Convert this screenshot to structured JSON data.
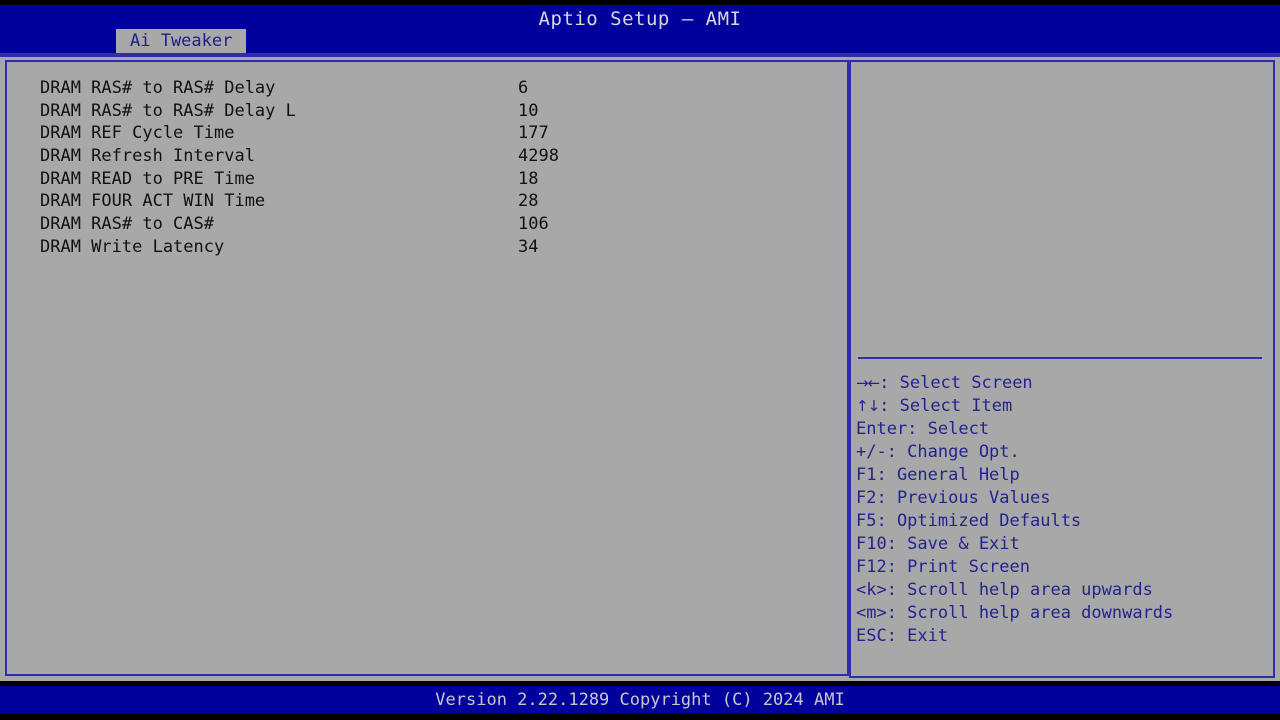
{
  "header": {
    "title": "Aptio Setup – AMI",
    "tabs": [
      {
        "label": "Ai Tweaker",
        "active": true
      }
    ]
  },
  "main": {
    "settings": [
      {
        "label": "DRAM RAS# to RAS# Delay",
        "value": "6"
      },
      {
        "label": "DRAM RAS# to RAS# Delay L",
        "value": "10"
      },
      {
        "label": "DRAM REF Cycle Time",
        "value": "177"
      },
      {
        "label": "DRAM Refresh Interval",
        "value": "4298"
      },
      {
        "label": "DRAM READ to PRE Time",
        "value": "18"
      },
      {
        "label": "DRAM FOUR ACT WIN Time",
        "value": "28"
      },
      {
        "label": "DRAM RAS# to CAS#",
        "value": "106"
      },
      {
        "label": "DRAM Write Latency",
        "value": "34"
      }
    ]
  },
  "help": {
    "description": "",
    "keys": [
      {
        "glyph": "→←",
        "text": ": Select Screen"
      },
      {
        "glyph": "↑↓",
        "text": ": Select Item"
      },
      {
        "glyph": "",
        "text": "Enter: Select"
      },
      {
        "glyph": "",
        "text": "+/-: Change Opt."
      },
      {
        "glyph": "",
        "text": "F1: General Help"
      },
      {
        "glyph": "",
        "text": "F2: Previous Values"
      },
      {
        "glyph": "",
        "text": "F5: Optimized Defaults"
      },
      {
        "glyph": "",
        "text": "F10: Save & Exit"
      },
      {
        "glyph": "",
        "text": "F12: Print Screen"
      },
      {
        "glyph": "",
        "text": "<k>: Scroll help area upwards"
      },
      {
        "glyph": "",
        "text": "<m>: Scroll help area downwards"
      },
      {
        "glyph": "",
        "text": "ESC: Exit"
      }
    ]
  },
  "footer": {
    "version_text": "Version 2.22.1289 Copyright (C) 2024 AMI"
  },
  "colors": {
    "header_blue": "#00009c",
    "panel_gray": "#a8a8a8",
    "border_blue": "#2e2eaa",
    "help_text_blue": "#23238e",
    "label_black": "#111111",
    "tab_gray": "#a8a8a8",
    "tab_text": "#202080"
  }
}
